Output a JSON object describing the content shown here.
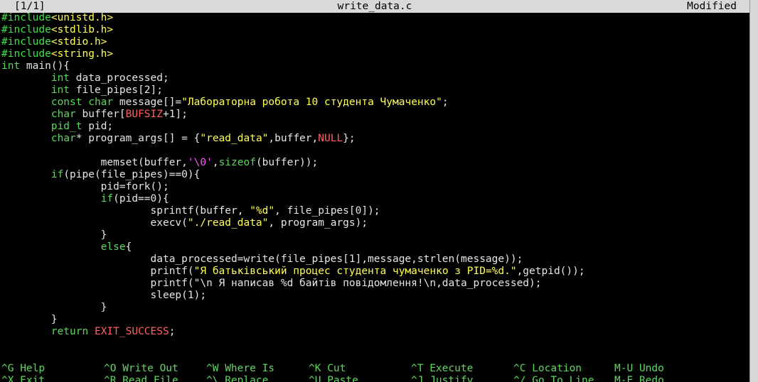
{
  "titlebar": {
    "left": "[1/1]",
    "filename": "write_data.c",
    "status": "Modified"
  },
  "code_lines": [
    [
      [
        "pp",
        "#include"
      ],
      [
        "inc",
        "<unistd.h>"
      ]
    ],
    [
      [
        "pp",
        "#include"
      ],
      [
        "inc",
        "<stdlib.h>"
      ]
    ],
    [
      [
        "pp",
        "#include"
      ],
      [
        "inc",
        "<stdio.h>"
      ]
    ],
    [
      [
        "pp",
        "#include"
      ],
      [
        "inc",
        "<string.h>"
      ]
    ],
    [
      [
        "ty",
        "int"
      ],
      [
        "tx",
        " main(){"
      ]
    ],
    [
      [
        "tx",
        "        "
      ],
      [
        "ty",
        "int"
      ],
      [
        "tx",
        " data_processed;"
      ]
    ],
    [
      [
        "tx",
        "        "
      ],
      [
        "ty",
        "int"
      ],
      [
        "tx",
        " file_pipes[2];"
      ]
    ],
    [
      [
        "tx",
        "        "
      ],
      [
        "ty",
        "const char"
      ],
      [
        "tx",
        " message[]="
      ],
      [
        "st",
        "\"Лабораторна робота 10 студента Чумаченко\""
      ],
      [
        "tx",
        ";"
      ]
    ],
    [
      [
        "tx",
        "        "
      ],
      [
        "ty",
        "char"
      ],
      [
        "tx",
        " buffer["
      ],
      [
        "mc",
        "BUFSIZ"
      ],
      [
        "tx",
        "+1];"
      ]
    ],
    [
      [
        "tx",
        "        "
      ],
      [
        "ty",
        "pid_t"
      ],
      [
        "tx",
        " pid;"
      ]
    ],
    [
      [
        "tx",
        "        "
      ],
      [
        "ty",
        "char"
      ],
      [
        "tx",
        "* program_args[] = {"
      ],
      [
        "st",
        "\"read_data\""
      ],
      [
        "tx",
        ",buffer,"
      ],
      [
        "mc",
        "NULL"
      ],
      [
        "tx",
        "};"
      ]
    ],
    [
      [
        "tx",
        ""
      ]
    ],
    [
      [
        "tx",
        "                memset(buffer,"
      ],
      [
        "ch",
        "'\\0'"
      ],
      [
        "tx",
        ","
      ],
      [
        "fn",
        "sizeof"
      ],
      [
        "tx",
        "(buffer));"
      ]
    ],
    [
      [
        "tx",
        "        "
      ],
      [
        "kw",
        "if"
      ],
      [
        "tx",
        "(pipe(file_pipes)==0){"
      ]
    ],
    [
      [
        "tx",
        "                pid=fork();"
      ]
    ],
    [
      [
        "tx",
        "                "
      ],
      [
        "kw",
        "if"
      ],
      [
        "tx",
        "(pid==0){"
      ]
    ],
    [
      [
        "tx",
        "                        sprintf(buffer, "
      ],
      [
        "st",
        "\"%d\""
      ],
      [
        "tx",
        ", file_pipes[0]);"
      ]
    ],
    [
      [
        "tx",
        "                        execv("
      ],
      [
        "st",
        "\"./read_data\""
      ],
      [
        "tx",
        ", program_args);"
      ]
    ],
    [
      [
        "tx",
        "                }"
      ]
    ],
    [
      [
        "tx",
        "                "
      ],
      [
        "kw",
        "else"
      ],
      [
        "tx",
        "{"
      ]
    ],
    [
      [
        "tx",
        "                        data_processed=write(file_pipes[1],message,strlen(message));"
      ]
    ],
    [
      [
        "tx",
        "                        printf("
      ],
      [
        "st",
        "\"Я батьківський процес студента чумаченко з PID=%d.\""
      ],
      [
        "tx",
        ",getpid());"
      ]
    ],
    [
      [
        "tx",
        "                        printf(\"\\n Я написав %d байтів повідомлення!\\n,data_processed);"
      ]
    ],
    [
      [
        "tx",
        "                        sleep(1);"
      ]
    ],
    [
      [
        "tx",
        "                }"
      ]
    ],
    [
      [
        "tx",
        "        }"
      ]
    ],
    [
      [
        "tx",
        "        "
      ],
      [
        "kw",
        "return"
      ],
      [
        "tx",
        " "
      ],
      [
        "mc",
        "EXIT_SUCCESS"
      ],
      [
        "tx",
        ";"
      ]
    ]
  ],
  "shortcuts_row1": [
    {
      "key": "^G",
      "label": "Help"
    },
    {
      "key": "^O",
      "label": "Write Out"
    },
    {
      "key": "^W",
      "label": "Where Is"
    },
    {
      "key": "^K",
      "label": "Cut"
    },
    {
      "key": "^T",
      "label": "Execute"
    },
    {
      "key": "^C",
      "label": "Location"
    },
    {
      "key": "M-U",
      "label": "Undo"
    }
  ],
  "shortcuts_row2": [
    {
      "key": "^X",
      "label": "Exit"
    },
    {
      "key": "^R",
      "label": "Read File"
    },
    {
      "key": "^\\",
      "label": "Replace"
    },
    {
      "key": "^U",
      "label": "Paste"
    },
    {
      "key": "^J",
      "label": "Justify"
    },
    {
      "key": "^/",
      "label": "Go To Line"
    },
    {
      "key": "M-E",
      "label": "Redo"
    }
  ],
  "colors": {
    "background": "#000000",
    "titlebar": "#d9d9d9",
    "preprocessor": "#3fe04a",
    "string": "#ffff55",
    "keyword": "#5fd75f",
    "macro": "#ff5f5f",
    "char_literal": "#ff55ff"
  }
}
